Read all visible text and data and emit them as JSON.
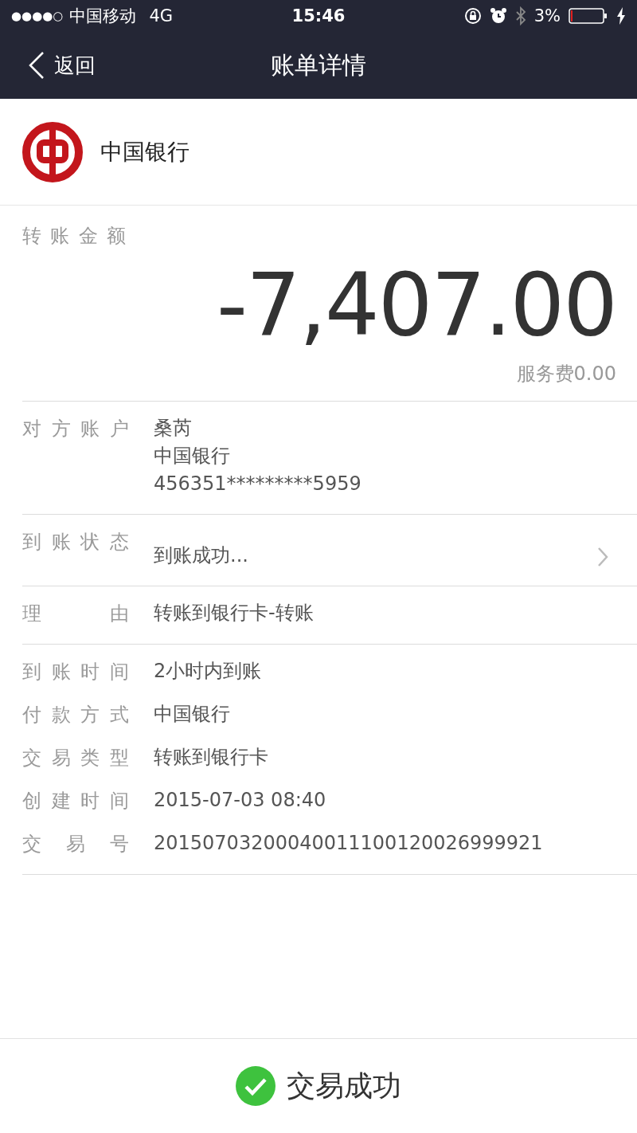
{
  "status_bar": {
    "signal": "●●●●○",
    "carrier": "中国移动",
    "network": "4G",
    "time": "15:46",
    "battery": "3%"
  },
  "nav": {
    "back": "返回",
    "title": "账单详情"
  },
  "bank": {
    "name": "中国银行"
  },
  "amount": {
    "label": "转账金额",
    "value": "-7,407.00",
    "fee": "服务费0.00"
  },
  "sections": [
    {
      "rows": [
        {
          "label": "对方账户",
          "lines": [
            "桑芮",
            "中国银行",
            "456351*********5959"
          ],
          "link": false
        }
      ]
    },
    {
      "rows": [
        {
          "label": "到账状态",
          "lines": [
            "到账成功..."
          ],
          "link": true
        }
      ]
    },
    {
      "rows": [
        {
          "label": "理由",
          "lines": [
            "转账到银行卡-转账"
          ],
          "link": false
        }
      ]
    },
    {
      "rows": [
        {
          "label": "到账时间",
          "lines": [
            "2小时内到账"
          ],
          "link": false
        },
        {
          "label": "付款方式",
          "lines": [
            "中国银行"
          ],
          "link": false
        },
        {
          "label": "交易类型",
          "lines": [
            "转账到银行卡"
          ],
          "link": false
        },
        {
          "label": "创建时间",
          "lines": [
            "2015-07-03 08:40"
          ],
          "link": false
        },
        {
          "label": "交易号",
          "lines": [
            "20150703200040011100120026999921"
          ],
          "link": false
        }
      ]
    }
  ],
  "result": {
    "text": "交易成功"
  }
}
